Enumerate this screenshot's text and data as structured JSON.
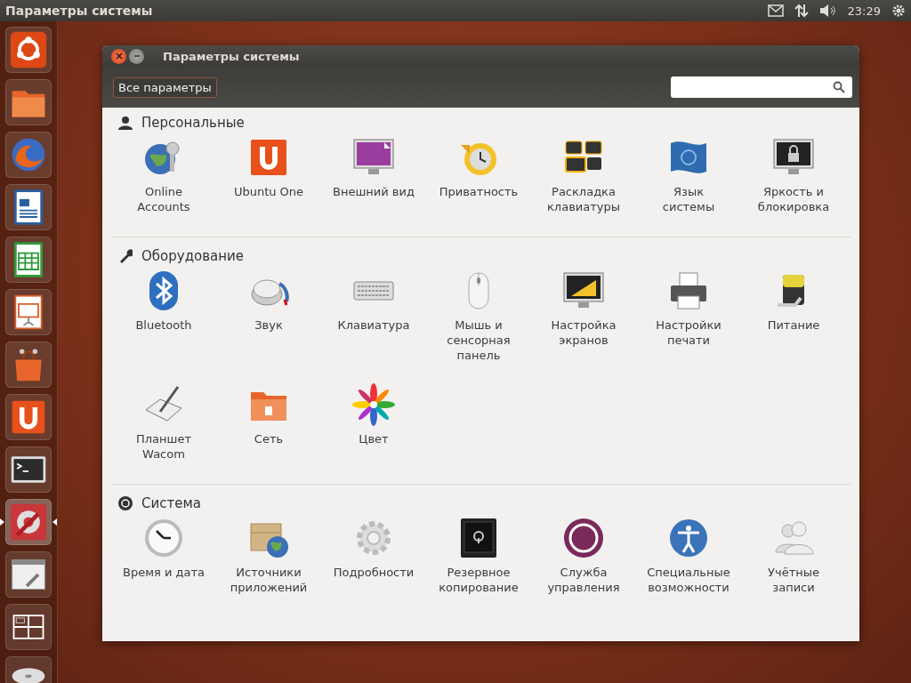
{
  "top_panel": {
    "title": "Параметры системы",
    "clock": "23:29"
  },
  "launcher": {
    "items": [
      {
        "selected": false
      },
      {
        "selected": false
      },
      {
        "selected": false
      },
      {
        "selected": false
      },
      {
        "selected": false
      },
      {
        "selected": false
      },
      {
        "selected": false
      },
      {
        "selected": false
      },
      {
        "selected": false
      },
      {
        "selected": true
      },
      {
        "selected": false
      },
      {
        "selected": false
      },
      {
        "selected": false
      }
    ]
  },
  "window": {
    "title": "Параметры системы",
    "all_settings_button": "Все параметры",
    "sections": [
      {
        "title": "Персональные",
        "items": [
          {
            "label": "Online\nAccounts"
          },
          {
            "label": "Ubuntu One"
          },
          {
            "label": "Внешний вид"
          },
          {
            "label": "Приватность"
          },
          {
            "label": "Раскладка\nклавиатуры"
          },
          {
            "label": "Язык\nсистемы"
          },
          {
            "label": "Яркость и\nблокировка"
          }
        ]
      },
      {
        "title": "Оборудование",
        "items": [
          {
            "label": "Bluetooth"
          },
          {
            "label": "Звук"
          },
          {
            "label": "Клавиатура"
          },
          {
            "label": "Мышь и\nсенсорная\nпанель"
          },
          {
            "label": "Настройка\nэкранов"
          },
          {
            "label": "Настройки\nпечати"
          },
          {
            "label": "Питание"
          },
          {
            "label": "Планшет\nWacom"
          },
          {
            "label": "Сеть"
          },
          {
            "label": "Цвет"
          }
        ]
      },
      {
        "title": "Система",
        "items": [
          {
            "label": "Время и дата"
          },
          {
            "label": "Источники\nприложений"
          },
          {
            "label": "Подробности"
          },
          {
            "label": "Резервное\nкопирование"
          },
          {
            "label": "Служба\nуправления"
          },
          {
            "label": "Специальные\nвозможности"
          },
          {
            "label": "Учётные\nзаписи"
          }
        ]
      }
    ]
  }
}
